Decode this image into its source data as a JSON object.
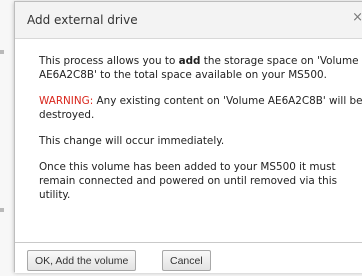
{
  "dialog": {
    "title": "Add external drive",
    "close_glyph": "×",
    "paragraphs": {
      "intro_pre": "This process allows you to ",
      "intro_bold": "add",
      "intro_post": " the storage space on 'Volume AE6A2C8B' to the total space available on your MS500.",
      "warning_label": "WARNING:",
      "warning_text": " Any existing content on 'Volume AE6A2C8B' will be destroyed.",
      "immediate": "This change will occur immediately.",
      "connected": "Once this volume has been added to your MS500 it must remain connected and powered on until removed via this utility."
    },
    "buttons": {
      "ok_label": "OK, Add the volume",
      "cancel_label": "Cancel"
    }
  },
  "colors": {
    "warning": "#d9261c",
    "titlebar_bg": "#f3f3f3"
  }
}
